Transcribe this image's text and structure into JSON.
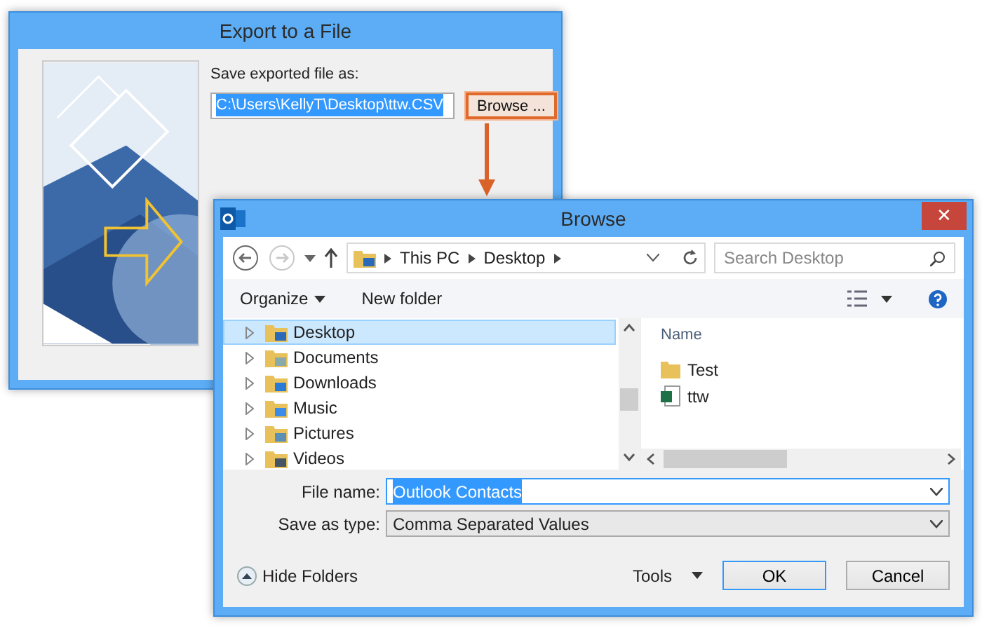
{
  "export_window": {
    "title": "Export to a File",
    "label": "Save exported file as:",
    "path_value": "C:\\Users\\KellyT\\Desktop\\ttw.CSV",
    "browse_button": {
      "label": "Browse ...",
      "highlighted": true
    }
  },
  "browse_window": {
    "title": "Browse",
    "close": "✕",
    "nav": {
      "back_disabled": false,
      "forward_disabled": true
    },
    "breadcrumb": [
      "This PC",
      "Desktop"
    ],
    "search": {
      "placeholder": "Search Desktop"
    },
    "toolbar": {
      "organize": "Organize",
      "new_folder": "New folder"
    },
    "tree": [
      {
        "label": "Desktop",
        "selected": true
      },
      {
        "label": "Documents",
        "selected": false
      },
      {
        "label": "Downloads",
        "selected": false
      },
      {
        "label": "Music",
        "selected": false
      },
      {
        "label": "Pictures",
        "selected": false
      },
      {
        "label": "Videos",
        "selected": false
      }
    ],
    "column": "Name",
    "files": [
      {
        "name": "Test",
        "kind": "folder"
      },
      {
        "name": "ttw",
        "kind": "spreadsheet"
      }
    ],
    "file_name": {
      "label": "File name:",
      "value": "Outlook Contacts"
    },
    "save_as_type": {
      "label": "Save as type:",
      "value": "Comma Separated Values"
    },
    "hide_folders": "Hide Folders",
    "tools": "Tools",
    "ok": "OK",
    "cancel": "Cancel"
  }
}
